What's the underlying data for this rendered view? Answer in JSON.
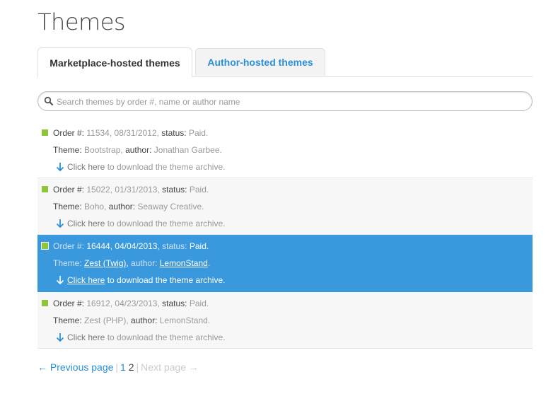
{
  "page_title": "Themes",
  "tabs": [
    {
      "label": "Marketplace-hosted themes",
      "active": true
    },
    {
      "label": "Author-hosted themes",
      "active": false
    }
  ],
  "search": {
    "placeholder": "Search themes by order #, name or author name",
    "value": ""
  },
  "labels": {
    "order": "Order #:",
    "status": "status:",
    "theme": "Theme:",
    "author": "author:",
    "download_link": "Click here",
    "download_rest": "to download the theme archive."
  },
  "orders": [
    {
      "number": "11534",
      "date": "08/31/2012",
      "status": "Paid.",
      "theme": "Bootstrap",
      "author": "Jonathan Garbee."
    },
    {
      "number": "15022",
      "date": "01/31/2013",
      "status": "Paid.",
      "theme": "Boho",
      "author": "Seaway Creative."
    },
    {
      "number": "16444",
      "date": "04/04/2013",
      "status": "Paid.",
      "theme": "Zest (Twig)",
      "author": "LemonStand",
      "selected": true
    },
    {
      "number": "16912",
      "date": "04/23/2013",
      "status": "Paid.",
      "theme": "Zest (PHP)",
      "author": "LemonStand."
    }
  ],
  "pagination": {
    "prev": "← Previous page",
    "pages": [
      "1",
      "2"
    ],
    "current": "2",
    "next": "Next page →",
    "divider": "|"
  },
  "colors": {
    "accent": "#2a8fd6",
    "selected_row": "#3a98dc",
    "status_square": "#8fc53a"
  },
  "icons": {
    "search": "magnifier-icon",
    "download": "arrow-down-icon"
  }
}
